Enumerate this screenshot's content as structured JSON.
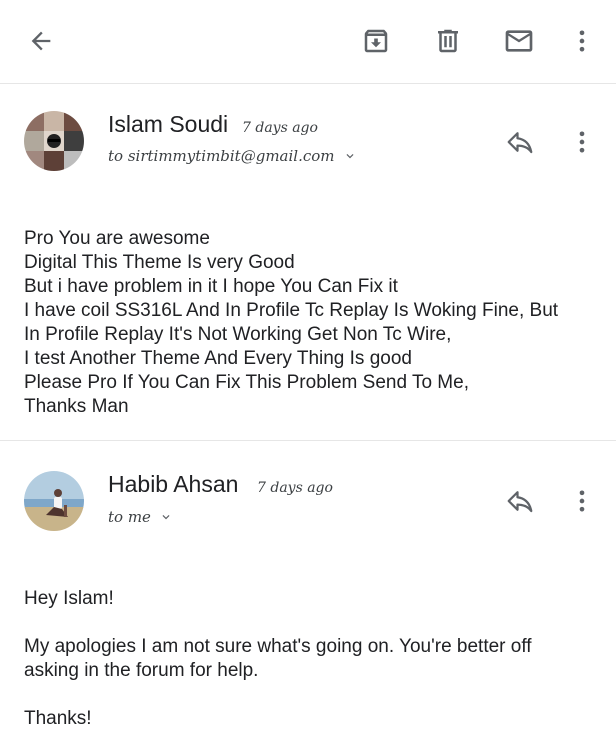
{
  "toolbar": {
    "back_icon": "arrow-left-icon",
    "archive_icon": "archive-icon",
    "delete_icon": "trash-icon",
    "mark_unread_icon": "envelope-icon",
    "more_icon": "more-vertical-icon"
  },
  "messages": [
    {
      "sender": "Islam Soudi",
      "time": "7 days ago",
      "recipient": "to sirtimmytimbit@gmail.com",
      "body": [
        "Pro You are awesome",
        "Digital This Theme Is very Good",
        "But i have problem in it I hope You Can Fix it",
        "I have coil SS316L And In Profile Tc Replay Is Woking Fine, But",
        "In Profile Replay It's Not Working Get Non Tc Wire,",
        "I test Another Theme And Every Thing Is good",
        "Please Pro If You Can Fix This Problem Send To Me,",
        "Thanks Man"
      ]
    },
    {
      "sender": "Habib Ahsan",
      "time": "7 days ago",
      "recipient": "to me",
      "body": [
        "Hey Islam!",
        "",
        "My apologies I am not sure what's going on. You're better off",
        "asking in the forum for help.",
        "",
        "Thanks!"
      ]
    }
  ],
  "colors": {
    "icon": "#5f6368",
    "text": "#202124",
    "divider": "#e6e6e6"
  }
}
